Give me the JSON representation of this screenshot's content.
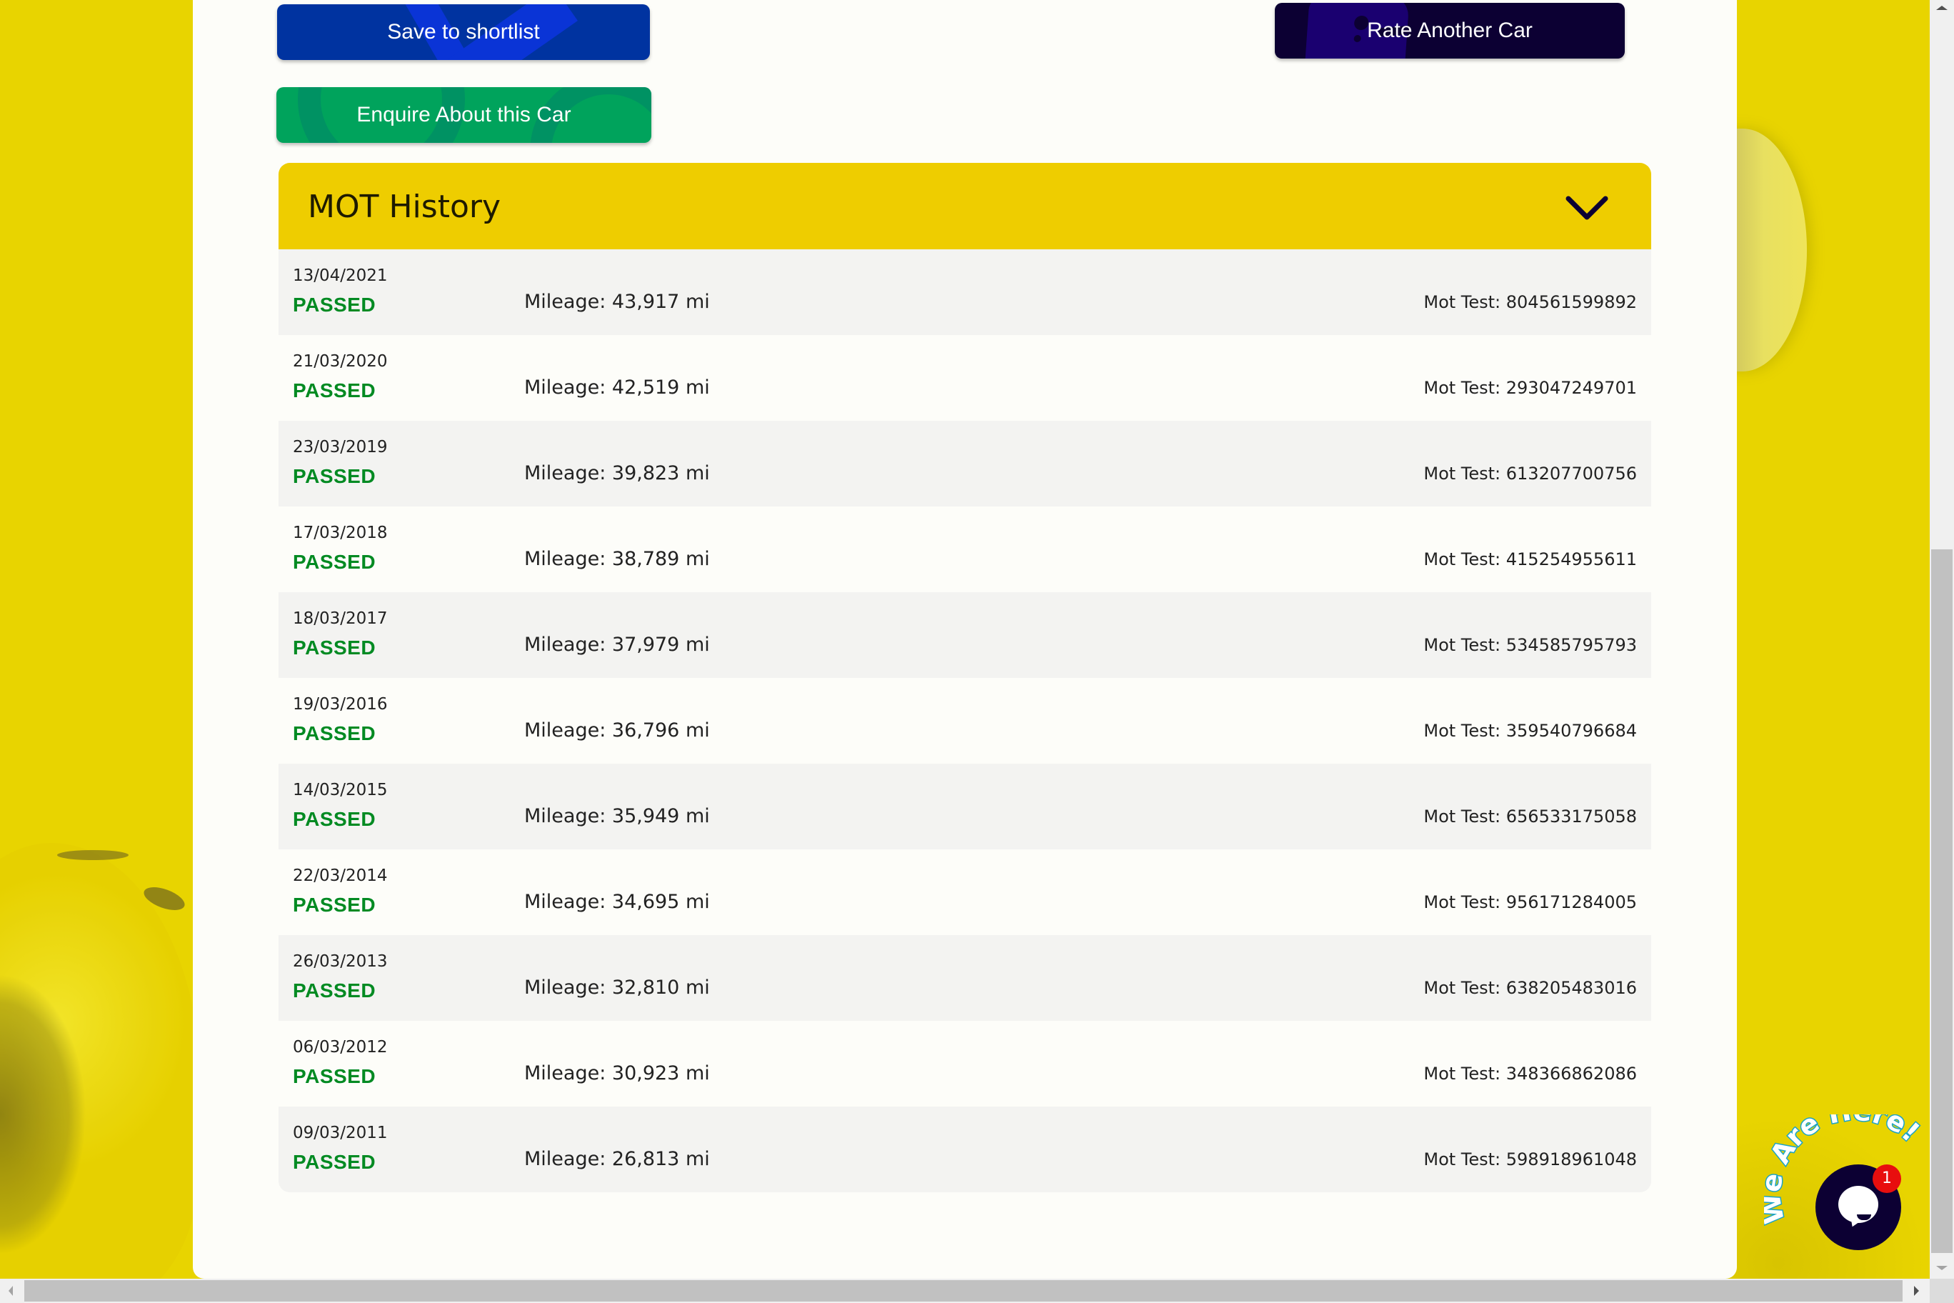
{
  "buttons": {
    "save_shortlist": "Save to shortlist",
    "enquire": "Enquire About this Car",
    "rate_another": "Rate Another Car"
  },
  "mot": {
    "title": "MOT History",
    "toggle_icon": "chevron-down-icon",
    "records": [
      {
        "date": "13/04/2021",
        "status": "PASSED",
        "mileage": "Mileage: 43,917 mi",
        "test": "Mot Test: 804561599892"
      },
      {
        "date": "21/03/2020",
        "status": "PASSED",
        "mileage": "Mileage: 42,519 mi",
        "test": "Mot Test: 293047249701"
      },
      {
        "date": "23/03/2019",
        "status": "PASSED",
        "mileage": "Mileage: 39,823 mi",
        "test": "Mot Test: 613207700756"
      },
      {
        "date": "17/03/2018",
        "status": "PASSED",
        "mileage": "Mileage: 38,789 mi",
        "test": "Mot Test: 415254955611"
      },
      {
        "date": "18/03/2017",
        "status": "PASSED",
        "mileage": "Mileage: 37,979 mi",
        "test": "Mot Test: 534585795793"
      },
      {
        "date": "19/03/2016",
        "status": "PASSED",
        "mileage": "Mileage: 36,796 mi",
        "test": "Mot Test: 359540796684"
      },
      {
        "date": "14/03/2015",
        "status": "PASSED",
        "mileage": "Mileage: 35,949 mi",
        "test": "Mot Test: 656533175058"
      },
      {
        "date": "22/03/2014",
        "status": "PASSED",
        "mileage": "Mileage: 34,695 mi",
        "test": "Mot Test: 956171284005"
      },
      {
        "date": "26/03/2013",
        "status": "PASSED",
        "mileage": "Mileage: 32,810 mi",
        "test": "Mot Test: 638205483016"
      },
      {
        "date": "06/03/2012",
        "status": "PASSED",
        "mileage": "Mileage: 30,923 mi",
        "test": "Mot Test: 348366862086"
      },
      {
        "date": "09/03/2011",
        "status": "PASSED",
        "mileage": "Mileage: 26,813 mi",
        "test": "Mot Test: 598918961048"
      }
    ]
  },
  "chat": {
    "label": "We Are Here!",
    "badge_count": "1",
    "icon": "chat-bubble-icon"
  },
  "colors": {
    "background_yellow": "#e8d400",
    "header_yellow": "#eecd00",
    "save_blue": "#0033a0",
    "enquire_green": "#00a35c",
    "rate_navy": "#0c0033",
    "passed_green": "#008a22",
    "badge_red": "#e80e0e"
  }
}
